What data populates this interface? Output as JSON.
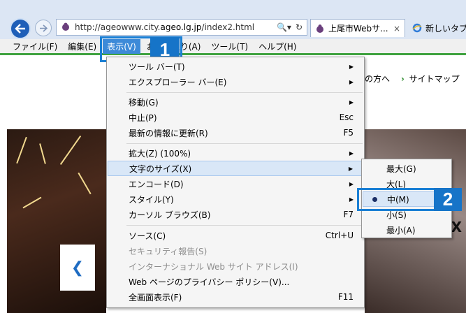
{
  "browser": {
    "url_prefix": "http://ageowww.city.",
    "url_host": "ageo.lg.jp",
    "url_suffix": "/index2.html",
    "search_icon": "🔍▾",
    "refresh_icon": "↻",
    "tabs": [
      {
        "title": "上尾市Webサ...",
        "close": "×"
      },
      {
        "title": "新しいタブ"
      }
    ]
  },
  "menubar": {
    "items": [
      "ファイル(F)",
      "編集(E)",
      "表示(V)",
      "お気に入り(A)",
      "ツール(T)",
      "ヘルプ(H)"
    ]
  },
  "view_menu": {
    "items": [
      {
        "label": "ツール バー(T)",
        "arrow": "▶"
      },
      {
        "label": "エクスプローラー バー(E)",
        "arrow": "▶"
      },
      {
        "label": "移動(G)",
        "arrow": "▶"
      },
      {
        "label": "中止(P)",
        "shortcut": "Esc"
      },
      {
        "label": "最新の情報に更新(R)",
        "shortcut": "F5"
      },
      {
        "label": "拡大(Z) (100%)",
        "arrow": "▶"
      },
      {
        "label": "文字のサイズ(X)",
        "arrow": "▶"
      },
      {
        "label": "エンコード(D)",
        "arrow": "▶"
      },
      {
        "label": "スタイル(Y)",
        "arrow": "▶"
      },
      {
        "label": "カーソル ブラウズ(B)",
        "shortcut": "F7"
      },
      {
        "label": "ソース(C)",
        "shortcut": "Ctrl+U"
      },
      {
        "label": "セキュリティ報告(S)"
      },
      {
        "label": "インターナショナル Web サイト アドレス(I)"
      },
      {
        "label": "Web ページのプライバシー ポリシー(V)..."
      },
      {
        "label": "全画面表示(F)",
        "shortcut": "F11"
      }
    ]
  },
  "size_submenu": {
    "items": [
      "最大(G)",
      "大(L)",
      "中(M)",
      "小(S)",
      "最小(A)"
    ],
    "selected": "中(M)"
  },
  "callouts": [
    "1",
    "2"
  ],
  "page": {
    "links": [
      "の方へ",
      "サイトマップ"
    ],
    "carousel_prev": "❮",
    "right_mark": "X"
  },
  "colors": {
    "accent": "#1674c8",
    "menu_highlight": "#d9e7f7",
    "green_bar": "#3fa23f"
  }
}
